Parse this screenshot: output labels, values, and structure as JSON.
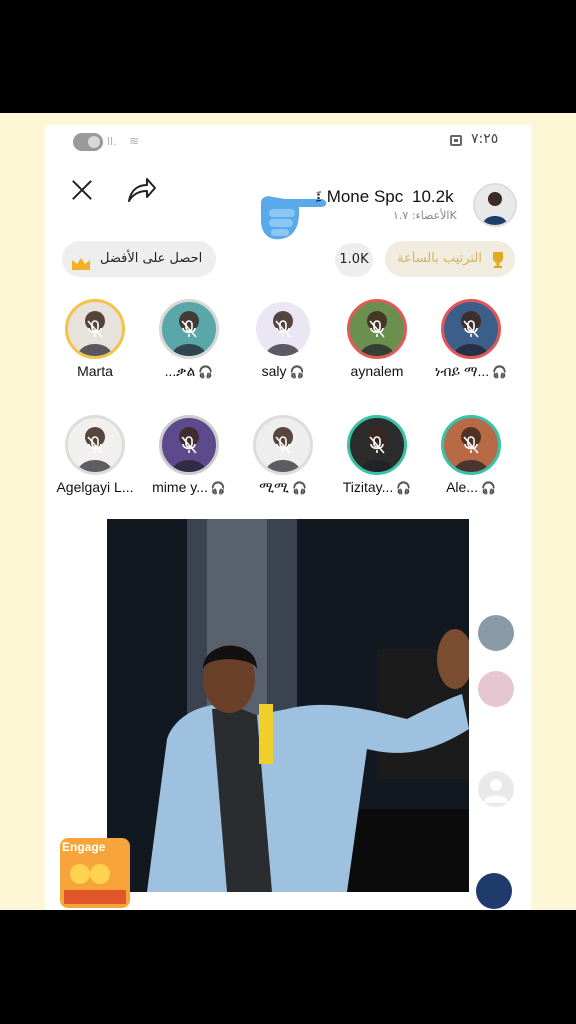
{
  "status_bar": {
    "time": "٧:٢٥",
    "signal": "ll.",
    "wifi": "≋"
  },
  "room": {
    "title": "፤ Mone Spc",
    "score": "10.2k",
    "members": "الأعضاء: ١.٧K"
  },
  "actions": {
    "get_best": "احصل على الأفضل",
    "count_badge": "1.0K",
    "hourly_rank": "الترتيب بالساعة"
  },
  "seats_row1": [
    {
      "name": "Marta",
      "tag": "",
      "ring": "#f3c34a",
      "bg": "#e8e2dc"
    },
    {
      "name": "...ቃል",
      "tag": "🎧",
      "ring": "#d8d8d8",
      "bg": "#5aa6a8"
    },
    {
      "name": "saly",
      "tag": "🎧",
      "ring": "#ffffff",
      "bg": "#ebe6f3"
    },
    {
      "name": "aynalem",
      "tag": "",
      "ring": "#e05a5a",
      "bg": "#6b8f4e"
    },
    {
      "name": "ነብይ ማ...",
      "tag": "🎧",
      "ring": "#e0565b",
      "bg": "#3c5f8a"
    }
  ],
  "seats_row2": [
    {
      "name": "Agelgayi L...",
      "tag": "",
      "ring": "#dddddd",
      "bg": "#f2f0ee"
    },
    {
      "name": "mime y...",
      "tag": "🎧",
      "ring": "#cccccc",
      "bg": "#5d4a8c"
    },
    {
      "name": "ሚሚ",
      "tag": "🎧",
      "ring": "#dddddd",
      "bg": "#efeeee"
    },
    {
      "name": "Tizitay...",
      "tag": "🎧",
      "ring": "#39c2a8",
      "bg": "#2c2c2c"
    },
    {
      "name": "Ale...",
      "tag": "🎧",
      "ring": "#39c2a8",
      "bg": "#b86a47"
    }
  ],
  "engage_label": "Engage",
  "colors": {
    "accent": "#e8425c",
    "rank_gold": "#d6b25c",
    "pane_bg": "#fdf7d6"
  }
}
